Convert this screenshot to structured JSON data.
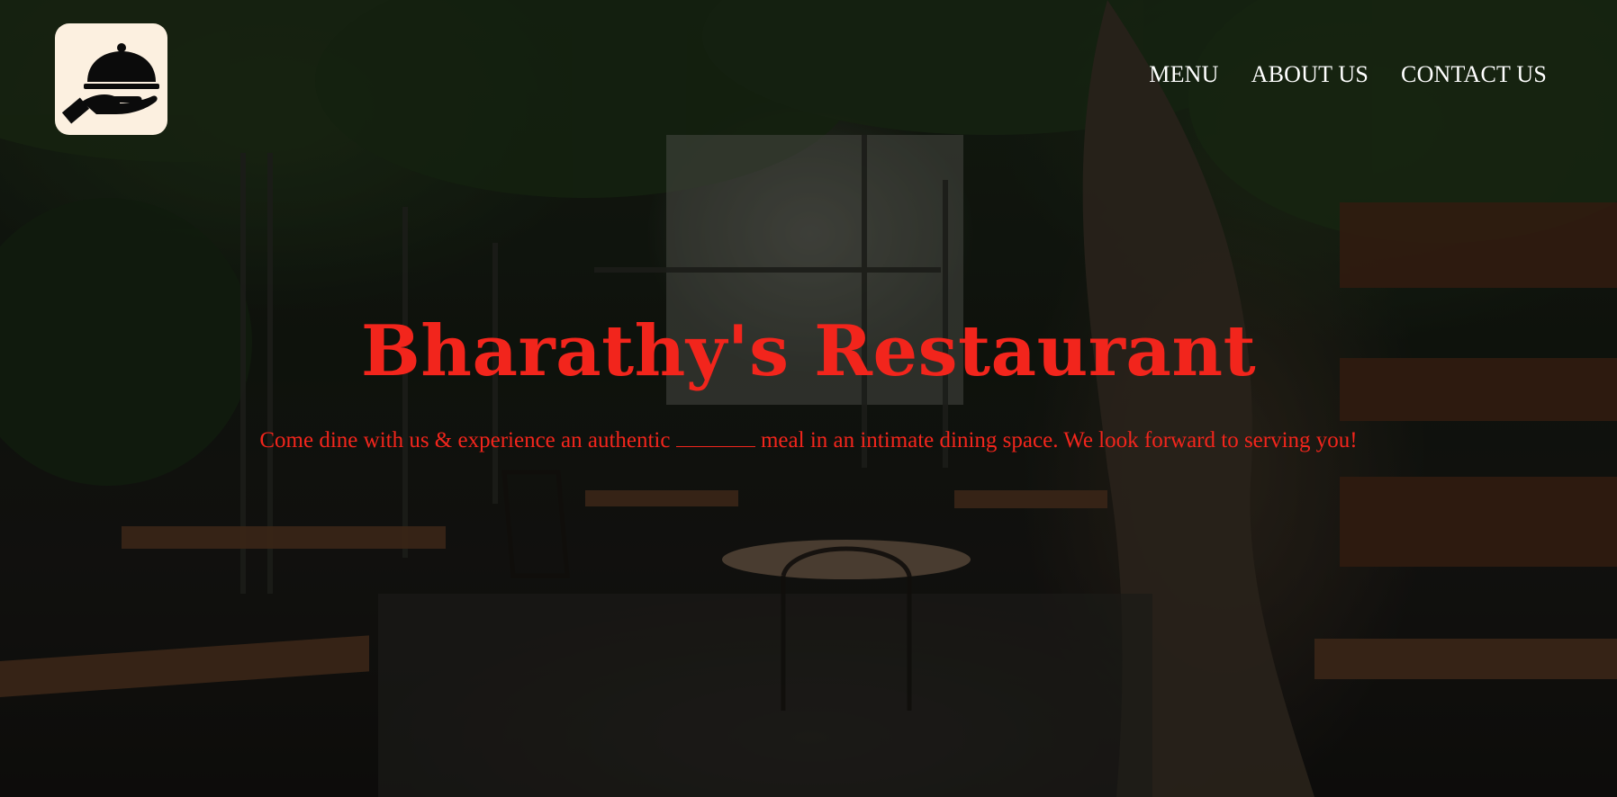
{
  "site": {
    "logo_icon": "serving-cloche-hand-icon",
    "brand_colors": {
      "accent": "#f2251c",
      "logo_bg": "#fcf0e0",
      "nav_text": "#ffffff"
    }
  },
  "nav": {
    "menu": "MENU",
    "about": "ABOUT US",
    "contact": "CONTACT US"
  },
  "hero": {
    "title": "Bharathy's Restaurant",
    "tagline_before": "Come dine with us & experience an authentic ",
    "tagline_after": " meal in an intimate dining space. We look forward to serving you!"
  }
}
